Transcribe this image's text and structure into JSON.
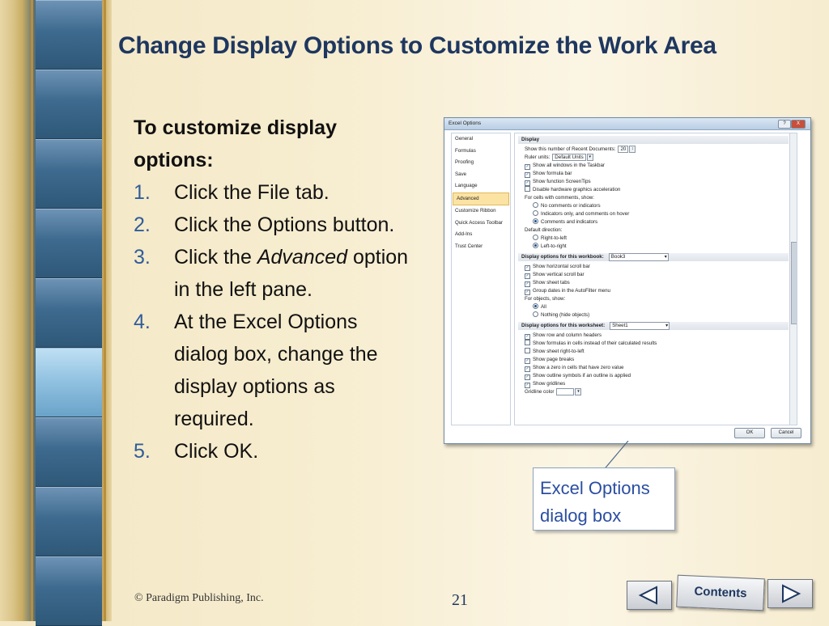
{
  "slide": {
    "title": "Change Display Options to Customize the Work Area",
    "intro": "To customize display options:",
    "steps": [
      {
        "num": "1.",
        "text": "Click the File tab."
      },
      {
        "num": "2.",
        "text": "Click the Options button."
      },
      {
        "num": "3.",
        "pre": "Click the ",
        "em": "Advanced",
        "post": " option in the left pane."
      },
      {
        "num": "4.",
        "text": "At the Excel Options dialog box, change the display options as required."
      },
      {
        "num": "5.",
        "text": "Click OK."
      }
    ],
    "callout": "Excel Options dialog box",
    "copyright": "© Paradigm Publishing, Inc.",
    "page_number": "21",
    "contents_label": "Contents"
  },
  "dialog": {
    "title": "Excel Options",
    "help": "?",
    "close": "X",
    "nav": [
      "General",
      "Formulas",
      "Proofing",
      "Save",
      "Language",
      "Advanced",
      "Customize Ribbon",
      "Quick Access Toolbar",
      "Add-Ins",
      "Trust Center"
    ],
    "selected_nav": 5,
    "display": {
      "header": "Display",
      "recent_label": "Show this number of Recent Documents:",
      "recent_value": "20",
      "ruler_label": "Ruler units:",
      "ruler_value": "Default Units",
      "checks": [
        {
          "label": "Show all windows in the Taskbar",
          "checked": true
        },
        {
          "label": "Show formula bar",
          "checked": true
        },
        {
          "label": "Show function ScreenTips",
          "checked": true
        },
        {
          "label": "Disable hardware graphics acceleration",
          "checked": false
        }
      ],
      "comments_label": "For cells with comments, show:",
      "comment_options": [
        {
          "label": "No comments or indicators",
          "on": false
        },
        {
          "label": "Indicators only, and comments on hover",
          "on": false
        },
        {
          "label": "Comments and indicators",
          "on": true
        }
      ],
      "direction_label": "Default direction:",
      "direction_options": [
        {
          "label": "Right-to-left",
          "on": false
        },
        {
          "label": "Left-to-right",
          "on": true
        }
      ]
    },
    "workbook": {
      "header": "Display options for this workbook:",
      "selected": "Book3",
      "checks": [
        {
          "label": "Show horizontal scroll bar",
          "checked": true
        },
        {
          "label": "Show vertical scroll bar",
          "checked": true
        },
        {
          "label": "Show sheet tabs",
          "checked": true
        },
        {
          "label": "Group dates in the AutoFilter menu",
          "checked": true
        }
      ],
      "objects_label": "For objects, show:",
      "object_options": [
        {
          "label": "All",
          "on": true
        },
        {
          "label": "Nothing (hide objects)",
          "on": false
        }
      ]
    },
    "worksheet": {
      "header": "Display options for this worksheet:",
      "selected": "Sheet1",
      "checks": [
        {
          "label": "Show row and column headers",
          "checked": true
        },
        {
          "label": "Show formulas in cells instead of their calculated results",
          "checked": false
        },
        {
          "label": "Show sheet right-to-left",
          "checked": false
        },
        {
          "label": "Show page breaks",
          "checked": true
        },
        {
          "label": "Show a zero in cells that have zero value",
          "checked": true
        },
        {
          "label": "Show outline symbols if an outline is applied",
          "checked": true
        },
        {
          "label": "Show gridlines",
          "checked": true
        }
      ],
      "gridline_label": "Gridline color"
    },
    "ok": "OK",
    "cancel": "Cancel"
  }
}
